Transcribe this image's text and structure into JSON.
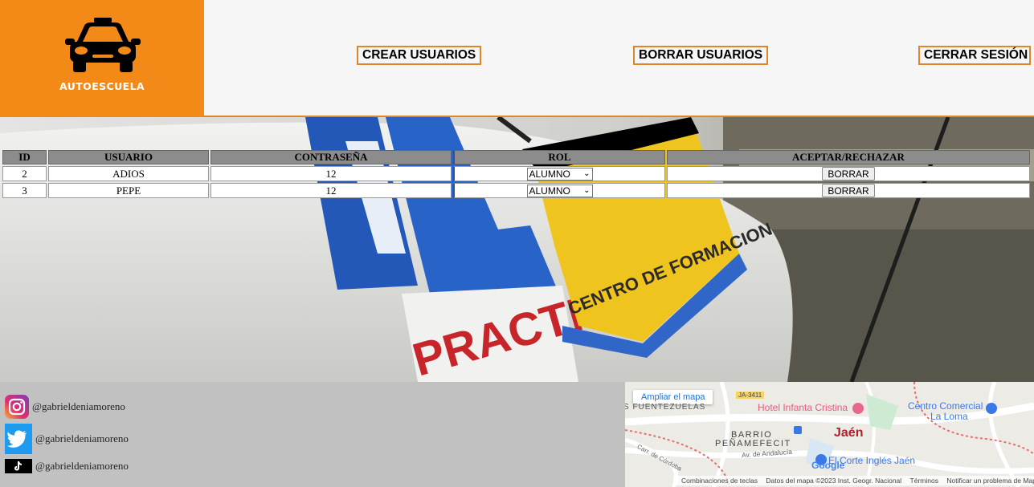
{
  "header": {
    "logo_text": "AUTOESCUELA",
    "nav": {
      "crear": "CREAR USUARIOS",
      "borrar": "BORRAR USUARIOS",
      "cerrar": "CERRAR SESIÓN"
    }
  },
  "hero": {
    "sign_text": "PRACTICAS",
    "badge_text": "CENTRO DE FORMACION"
  },
  "table": {
    "headers": [
      "ID",
      "USUARIO",
      "CONTRASEÑA",
      "ROL",
      "ACEPTAR/RECHAZAR"
    ],
    "rows": [
      {
        "id": "2",
        "usuario": "ADIOS",
        "contrasena": "12",
        "rol": "ALUMNO",
        "action": "BORRAR"
      },
      {
        "id": "3",
        "usuario": "PEPE",
        "contrasena": "12",
        "rol": "ALUMNO",
        "action": "BORRAR"
      }
    ]
  },
  "footer": {
    "social": [
      {
        "icon": "instagram-icon",
        "handle": "@gabrieldeniamoreno"
      },
      {
        "icon": "twitter-icon",
        "handle": "@gabrieldeniamoreno"
      },
      {
        "icon": "tiktok-icon",
        "handle": "@gabrieldeniamoreno"
      }
    ]
  },
  "map": {
    "enlarge_label": "Ampliar el mapa",
    "road_badge": "JA-3411",
    "labels": {
      "fuentezuelas": "S FUENTEZUELAS",
      "hotel": "Hotel Infanta Cristina",
      "centro_comercial_1": "Centro Comercial",
      "centro_comercial_2": "La Loma",
      "barrio_1": "BARRIO",
      "barrio_2": "PEÑAMEFECIT",
      "city": "Jaén",
      "avenida": "Av. de Andalucía",
      "carretera": "Carr. de Córdoba",
      "corte_ingles": "El Corte Inglés Jaén",
      "google": "Google"
    },
    "footer": {
      "shortcuts": "Combinaciones de teclas",
      "data": "Datos del mapa ©2023 Inst. Geogr. Nacional",
      "terms": "Términos",
      "report": "Notificar un problema de Maps"
    }
  },
  "colors": {
    "brand_orange": "#f38a18",
    "header_bg": "#f6f6f6",
    "table_header": "#8c8c8c",
    "footer_bg": "#c1c1c1"
  }
}
